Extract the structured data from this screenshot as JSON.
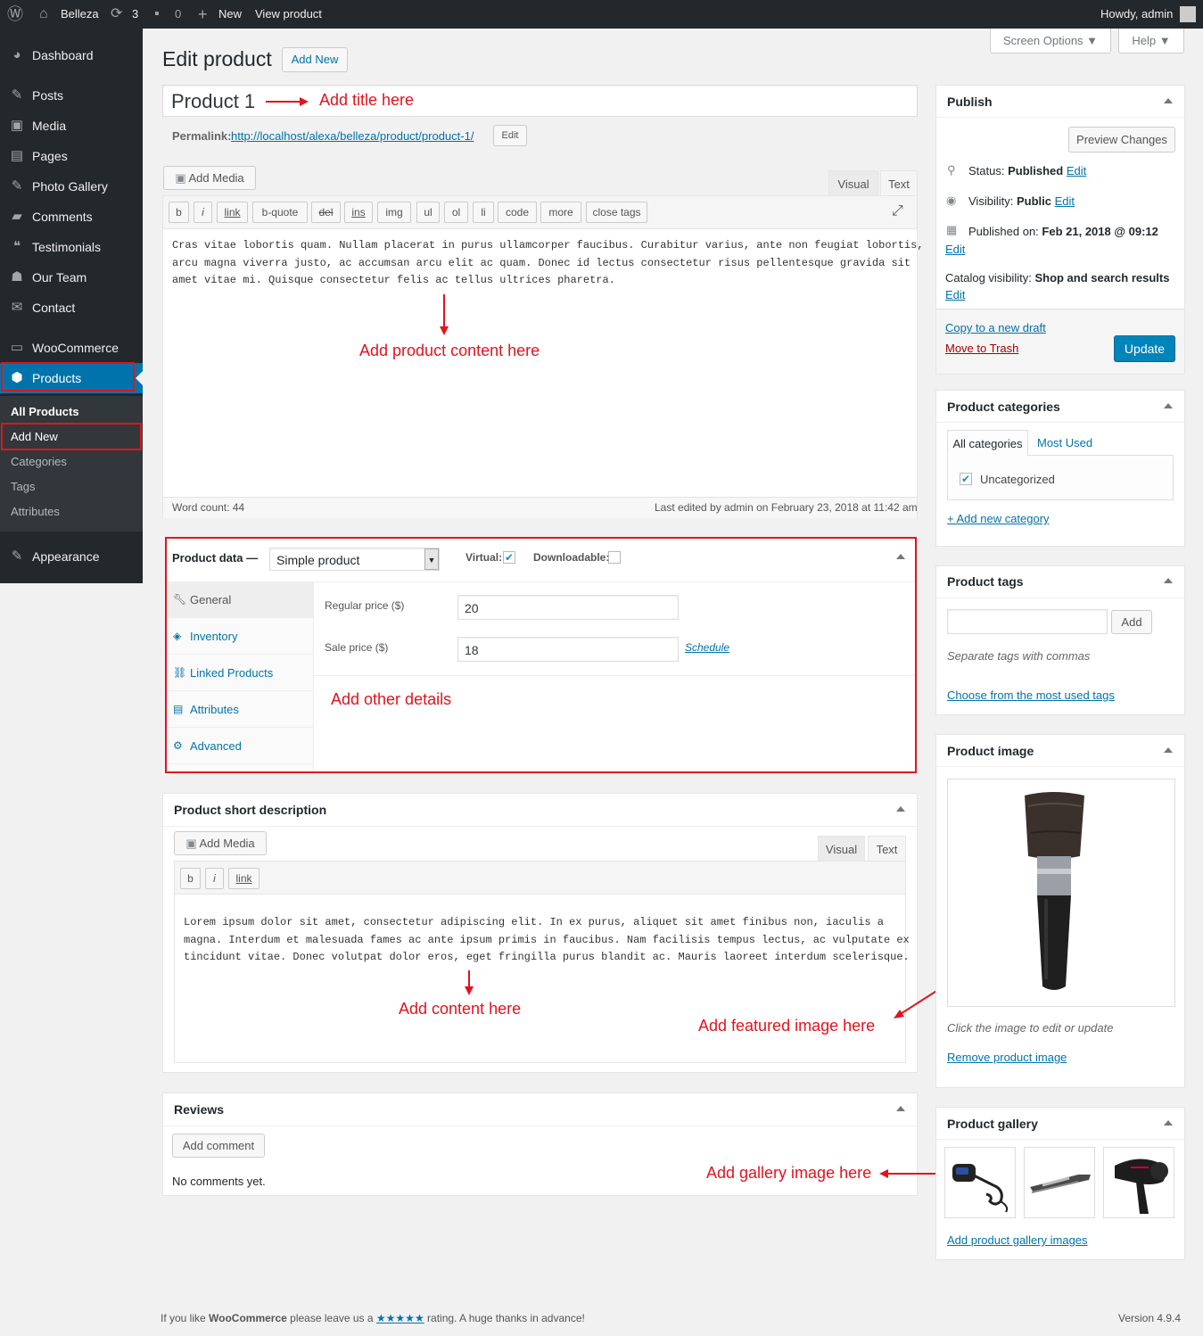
{
  "adminbar": {
    "site_name": "Belleza",
    "updates_count": "3",
    "comments_count": "0",
    "new_label": "New",
    "view_label": "View product",
    "howdy": "Howdy, admin"
  },
  "sidebar": {
    "items": [
      {
        "label": "Dashboard"
      },
      {
        "label": "Posts"
      },
      {
        "label": "Media"
      },
      {
        "label": "Pages"
      },
      {
        "label": "Photo Gallery"
      },
      {
        "label": "Comments"
      },
      {
        "label": "Testimonials"
      },
      {
        "label": "Our Team"
      },
      {
        "label": "Contact"
      },
      {
        "label": "WooCommerce"
      },
      {
        "label": "Products"
      },
      {
        "label": "Appearance"
      }
    ],
    "submenu": [
      "All Products",
      "Add New",
      "Categories",
      "Tags",
      "Attributes"
    ]
  },
  "header": {
    "screen_options": "Screen Options",
    "help": "Help",
    "title": "Edit product",
    "add_new": "Add New"
  },
  "editor": {
    "product_title": "Product 1",
    "permalink_label": "Permalink:",
    "permalink_url": "http://localhost/alexa/belleza/product/product-1/",
    "permalink_edit": "Edit",
    "add_media": "Add Media",
    "tab_visual": "Visual",
    "tab_text": "Text",
    "quicktags": [
      "b",
      "i",
      "link",
      "b-quote",
      "del",
      "ins",
      "img",
      "ul",
      "ol",
      "li",
      "code",
      "more",
      "close tags"
    ],
    "content_lines": [
      "Cras vitae lobortis quam. Nullam placerat in purus ullamcorper faucibus. Curabitur varius, ante non feugiat lobortis,",
      "arcu magna viverra justo, ac accumsan arcu elit ac quam. Donec id lectus consectetur risus pellentesque gravida sit",
      "amet vitae mi. Quisque consectetur felis ac tellus ultrices pharetra."
    ],
    "word_count": "Word count: 44",
    "last_edited": "Last edited by admin on February 23, 2018 at 11:42 am"
  },
  "annotations": {
    "title": "Add title here",
    "content": "Add product content here",
    "details": "Add other details",
    "short": "Add content here",
    "featured": "Add featured image here",
    "gallery": "Add gallery image here"
  },
  "product_data": {
    "label": "Product data —",
    "type_value": "Simple product",
    "virtual_label": "Virtual:",
    "virtual_checked": true,
    "downloadable_label": "Downloadable:",
    "downloadable_checked": false,
    "tabs": [
      "General",
      "Inventory",
      "Linked Products",
      "Attributes",
      "Advanced"
    ],
    "regular_price_label": "Regular price ($)",
    "regular_price": "20",
    "sale_price_label": "Sale price ($)",
    "sale_price": "18",
    "schedule": "Schedule"
  },
  "short_description": {
    "title": "Product short description",
    "add_media": "Add Media",
    "tab_visual": "Visual",
    "tab_text": "Text",
    "quicktags": [
      "b",
      "i",
      "link"
    ],
    "content_lines": [
      "Lorem ipsum dolor sit amet, consectetur adipiscing elit. In ex purus, aliquet sit amet finibus non, iaculis a",
      "magna. Interdum et malesuada fames ac ante ipsum primis in faucibus. Nam facilisis tempus lectus, ac vulputate ex",
      "tincidunt vitae. Donec volutpat dolor eros, eget fringilla purus blandit ac. Mauris laoreet interdum scelerisque."
    ]
  },
  "reviews": {
    "title": "Reviews",
    "add_comment": "Add comment",
    "no_comments": "No comments yet."
  },
  "publish": {
    "title": "Publish",
    "preview": "Preview Changes",
    "status_label": "Status:",
    "status_value": "Published",
    "visibility_label": "Visibility:",
    "visibility_value": "Public",
    "published_label": "Published on:",
    "published_value": "Feb 21, 2018 @ 09:12",
    "catalog_label": "Catalog visibility:",
    "catalog_value": "Shop and search results",
    "edit": "Edit",
    "copy_draft": "Copy to a new draft",
    "trash": "Move to Trash",
    "update": "Update"
  },
  "categories": {
    "title": "Product categories",
    "tab_all": "All categories",
    "tab_most": "Most Used",
    "items": [
      {
        "label": "Uncategorized",
        "checked": true
      }
    ],
    "add_new": "+ Add new category"
  },
  "tags": {
    "title": "Product tags",
    "input_value": "",
    "add": "Add",
    "hint": "Separate tags with commas",
    "choose": "Choose from the most used tags"
  },
  "product_image": {
    "title": "Product image",
    "hint": "Click the image to edit or update",
    "remove": "Remove product image"
  },
  "gallery": {
    "title": "Product gallery",
    "add": "Add product gallery images"
  },
  "footer": {
    "text_pre": "If you like ",
    "brand": "WooCommerce",
    "text_mid": " please leave us a ",
    "stars": "★★★★★",
    "text_post": " rating. A huge thanks in advance!",
    "version": "Version 4.9.4"
  },
  "colors": {
    "accent": "#0073aa",
    "annotation_red": "#e0141d",
    "admin_dark": "#23282d",
    "update_button": "#0085ba"
  }
}
